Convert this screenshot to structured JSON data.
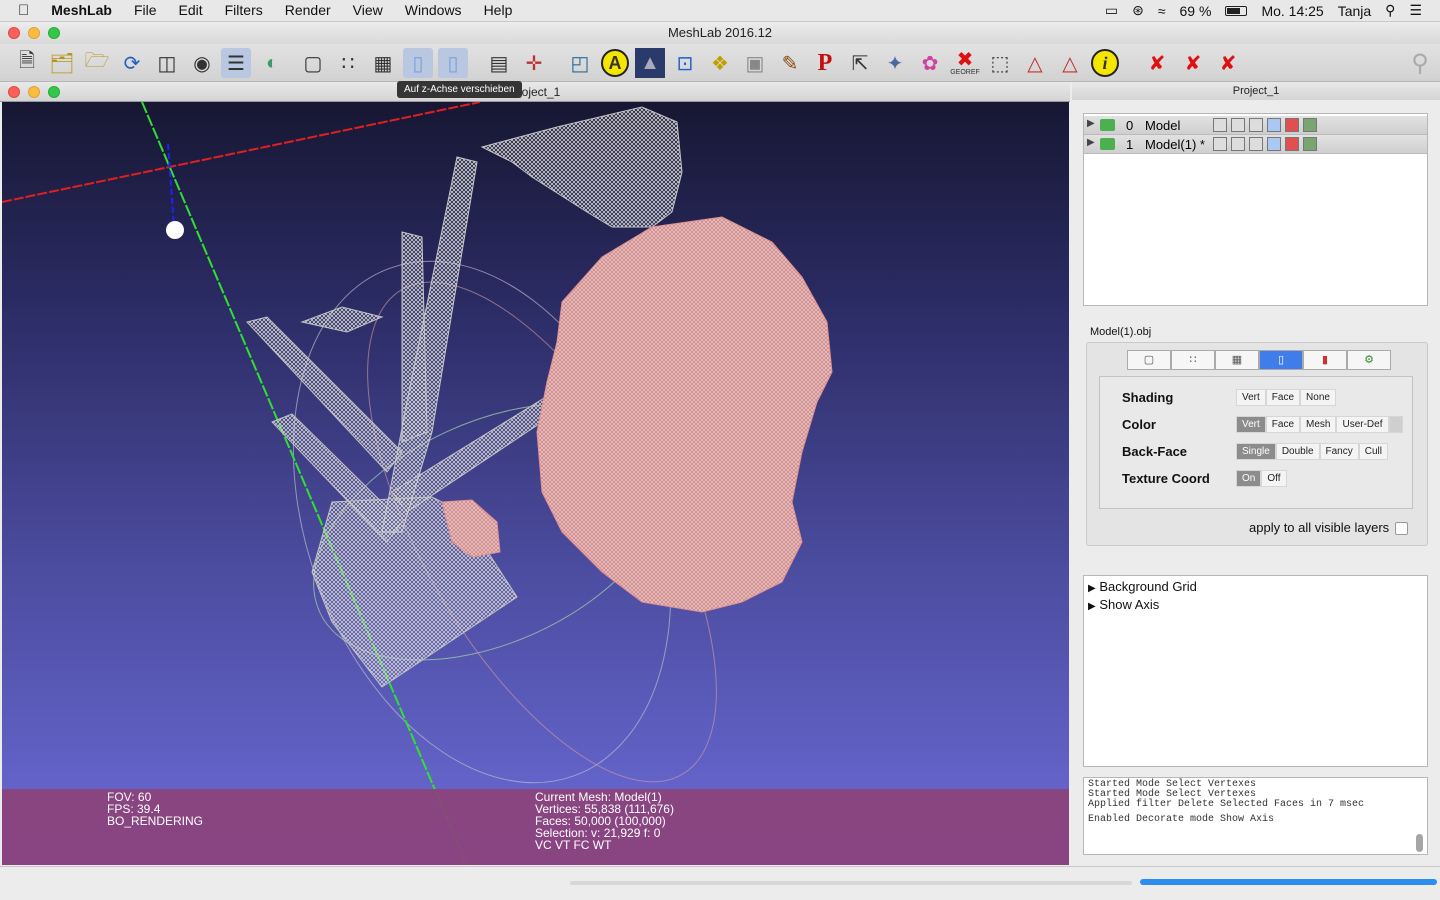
{
  "menubar": {
    "app_name": "MeshLab",
    "items": [
      "File",
      "Edit",
      "Filters",
      "Render",
      "View",
      "Windows",
      "Help"
    ],
    "battery": "69 %",
    "clock": "Mo. 14:25",
    "user": "Tanja"
  },
  "window": {
    "title": "MeshLab 2016.12"
  },
  "toolbar": {
    "tooltip": "Auf z-Achse verschieben",
    "icons": [
      "new-project-icon",
      "open-mesh-icon",
      "open-project-icon",
      "reload-icon",
      "save-icon",
      "snapshot-icon",
      "layers-icon",
      "shader-icon",
      "bbox-icon",
      "points-icon",
      "wireframe-icon",
      "flat-icon",
      "smooth-icon",
      "texture-icon",
      "axis-icon",
      "trackball-icon",
      "annotate-icon",
      "measure-icon",
      "manipulator-icon",
      "align-icon",
      "raster-icon",
      "paint-icon",
      "pickpoints-icon",
      "select-vertex-icon",
      "select-face-icon",
      "color-icon",
      "georef-icon",
      "select-area-icon",
      "select-conn-icon",
      "select-point-icon",
      "info-icon",
      "delete-vert-icon",
      "delete-face-icon",
      "delete-all-icon",
      "search-icon"
    ],
    "georef_label": "GEOREF"
  },
  "viewport": {
    "title": "Project_1",
    "info_left": [
      "FOV: 60",
      "FPS:   39.4",
      "BO_RENDERING"
    ],
    "info_right": [
      "Current Mesh: Model(1)",
      "Vertices: 55,838    (111,676)",
      "Faces: 50,000    (100,000)",
      "Selection: v: 21,929 f: 0",
      "VC VT FC WT"
    ],
    "colors": {
      "x_axis": "#e02020",
      "y_axis": "#20d020",
      "z_axis": "#2020e0",
      "mesh": "#c8c8c8",
      "selection": "#e08080"
    }
  },
  "panel": {
    "title": "Project_1",
    "layers": [
      {
        "index": "0",
        "name": "Model"
      },
      {
        "index": "1",
        "name": "Model(1) *"
      }
    ],
    "mesh_file": "Model(1).obj",
    "rendering": {
      "shading": {
        "label": "Shading",
        "options": [
          "Vert",
          "Face",
          "None"
        ],
        "selected": ""
      },
      "color": {
        "label": "Color",
        "options": [
          "Vert",
          "Face",
          "Mesh",
          "User-Def"
        ],
        "selected": "Vert"
      },
      "backface": {
        "label": "Back-Face",
        "options": [
          "Single",
          "Double",
          "Fancy",
          "Cull"
        ],
        "selected": "Single"
      },
      "texcoord": {
        "label": "Texture Coord",
        "options": [
          "On",
          "Off"
        ],
        "selected": "On"
      }
    },
    "apply_all": "apply to all visible layers",
    "decorators": [
      "Background Grid",
      "Show Axis"
    ],
    "log": [
      "Started Mode Select Vertexes",
      "Started Mode Select Vertexes",
      "Applied filter Delete Selected Faces in 7 msec",
      "Enabled Decorate mode Show Axis"
    ]
  }
}
